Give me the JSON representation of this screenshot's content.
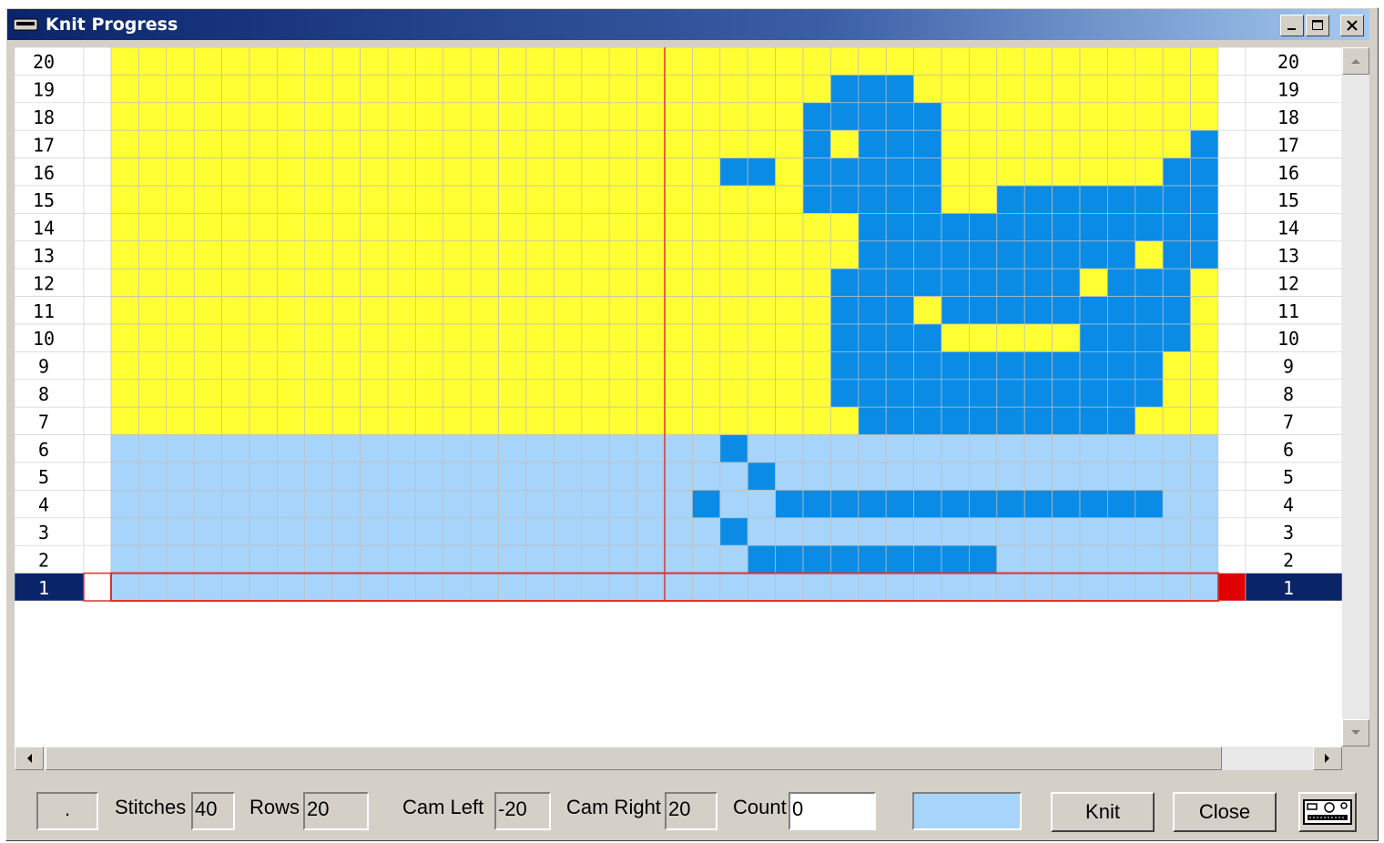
{
  "window": {
    "title": "Knit Progress",
    "title_icon": "knitting-machine-icon"
  },
  "colors": {
    "background_upper": "#ffff33",
    "background_lower": "#a6d4fa",
    "pattern": "#0a8ce6",
    "grid_line": "#bfbfbf",
    "center_line": "#e03030",
    "current_row_bg": "#0a246a",
    "current_row_marker": "#e00000"
  },
  "pattern": {
    "stitches": 40,
    "rows": 20,
    "current_row": 1,
    "row_labels": [
      "20",
      "19",
      "18",
      "17",
      "16",
      "15",
      "14",
      "13",
      "12",
      "11",
      "10",
      "9",
      "8",
      "7",
      "6",
      "5",
      "4",
      "3",
      "2",
      "1"
    ],
    "background_split_row": 6,
    "filled": [
      {
        "row": 19,
        "cols": [
          26,
          27,
          28
        ]
      },
      {
        "row": 18,
        "cols": [
          25,
          26,
          27,
          28,
          29
        ]
      },
      {
        "row": 17,
        "cols": [
          25,
          27,
          28,
          29,
          39
        ]
      },
      {
        "row": 16,
        "cols": [
          22,
          23,
          25,
          26,
          27,
          28,
          29,
          38,
          39
        ]
      },
      {
        "row": 15,
        "cols": [
          25,
          26,
          27,
          28,
          29,
          32,
          33,
          34,
          35,
          36,
          37,
          38,
          39
        ]
      },
      {
        "row": 14,
        "cols": [
          27,
          28,
          29,
          30,
          31,
          32,
          33,
          34,
          35,
          36,
          37,
          38,
          39
        ]
      },
      {
        "row": 13,
        "cols": [
          27,
          28,
          29,
          30,
          31,
          32,
          33,
          34,
          35,
          36,
          38,
          39
        ]
      },
      {
        "row": 12,
        "cols": [
          26,
          27,
          28,
          29,
          30,
          31,
          32,
          33,
          34,
          36,
          37,
          38
        ]
      },
      {
        "row": 11,
        "cols": [
          26,
          27,
          28,
          30,
          31,
          32,
          33,
          34,
          35,
          36,
          37,
          38
        ]
      },
      {
        "row": 10,
        "cols": [
          26,
          27,
          28,
          29,
          35,
          36,
          37,
          38
        ]
      },
      {
        "row": 9,
        "cols": [
          26,
          27,
          28,
          29,
          30,
          31,
          32,
          33,
          34,
          35,
          36,
          37
        ]
      },
      {
        "row": 8,
        "cols": [
          26,
          27,
          28,
          29,
          30,
          31,
          32,
          33,
          34,
          35,
          36,
          37
        ]
      },
      {
        "row": 7,
        "cols": [
          27,
          28,
          29,
          30,
          31,
          32,
          33,
          34,
          35,
          36
        ]
      },
      {
        "row": 6,
        "cols": [
          22
        ]
      },
      {
        "row": 5,
        "cols": [
          23
        ]
      },
      {
        "row": 4,
        "cols": [
          21,
          24,
          25,
          26,
          27,
          28,
          29,
          30,
          31,
          32,
          33,
          34,
          35,
          36,
          37
        ]
      },
      {
        "row": 3,
        "cols": [
          22
        ]
      },
      {
        "row": 2,
        "cols": [
          23,
          24,
          25,
          26,
          27,
          28,
          29,
          30,
          31
        ]
      }
    ]
  },
  "bottom": {
    "status_indicator": ".",
    "stitches_label": "Stitches",
    "stitches_value": "40",
    "rows_label": "Rows",
    "rows_value": "20",
    "cam_left_label": "Cam Left",
    "cam_left_value": "-20",
    "cam_right_label": "Cam Right",
    "cam_right_value": "20",
    "count_label": "Count",
    "count_value": "0",
    "color_swatch": "#a6d4fa",
    "knit_button": "Knit",
    "close_button": "Close",
    "machine_icon": "knitting-machine-icon"
  }
}
